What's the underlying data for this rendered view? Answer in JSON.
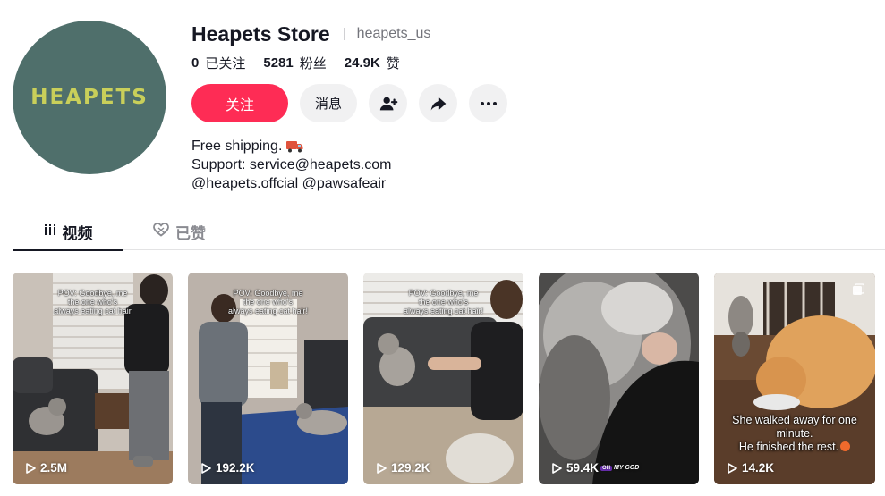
{
  "profile": {
    "avatar_text": "HEAPETS",
    "display_name": "Heapets Store",
    "username": "heapets_us",
    "stats": [
      {
        "value": "0",
        "label": "已关注"
      },
      {
        "value": "5281",
        "label": "粉丝"
      },
      {
        "value": "24.9K",
        "label": "赞"
      }
    ],
    "bio": [
      "Free shipping.",
      "Support: service@heapets.com",
      "@heapets.offcial @pawsafeair"
    ]
  },
  "actions": {
    "follow_label": "关注",
    "message_label": "消息",
    "add_friend_icon": "person-add-icon",
    "share_icon": "share-arrow-icon",
    "more_icon": "more-dots-icon"
  },
  "tabs": [
    {
      "label": "视频",
      "icon": "grid-bars-icon",
      "active": true
    },
    {
      "label": "已赞",
      "icon": "heart-outline-icon",
      "active": false
    }
  ],
  "videos": [
    {
      "overlay": [
        "POV: Goodbye, me",
        "the one who's",
        "always eating cat hair"
      ],
      "views": "2.5M"
    },
    {
      "overlay": [
        "POV: Goodbye, me",
        "the one who's",
        "always eating cat hair!"
      ],
      "views": "192.2K"
    },
    {
      "overlay": [
        "POV: Goodbye, me",
        "the one who's",
        "always eating cat hair!"
      ],
      "views": "129.2K"
    },
    {
      "overlay": [],
      "views": "59.4K",
      "tag_badge": "OH",
      "tag_text": "MY GOD"
    },
    {
      "overlay": [],
      "caption": [
        "She walked away for one",
        "minute.",
        "He finished the rest."
      ],
      "views": "14.2K"
    }
  ],
  "colors": {
    "accent": "#fe2c55",
    "avatar_bg": "#4f6f6b",
    "avatar_text": "#c9cf5a",
    "muted_text": "#73747b",
    "button_bg": "#f1f1f2"
  }
}
